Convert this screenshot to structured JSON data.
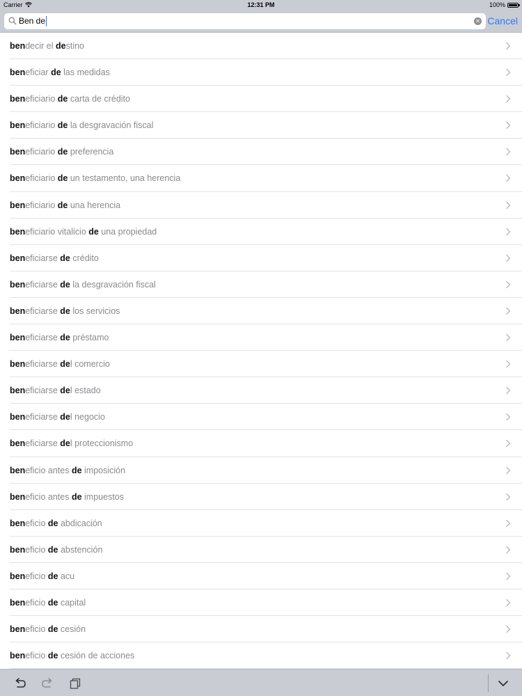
{
  "status_bar": {
    "carrier": "Carrier",
    "time": "12:31 PM",
    "battery": "100%"
  },
  "search": {
    "query": "Ben de",
    "cancel_label": "Cancel"
  },
  "results": [
    [
      {
        "t": "ben",
        "b": true
      },
      {
        "t": "decir el ",
        "b": false
      },
      {
        "t": "de",
        "b": true
      },
      {
        "t": "stino",
        "b": false
      }
    ],
    [
      {
        "t": "ben",
        "b": true
      },
      {
        "t": "eficiar ",
        "b": false
      },
      {
        "t": "de",
        "b": true
      },
      {
        "t": " las medidas",
        "b": false
      }
    ],
    [
      {
        "t": "ben",
        "b": true
      },
      {
        "t": "eficiario ",
        "b": false
      },
      {
        "t": "de",
        "b": true
      },
      {
        "t": " carta de crédito",
        "b": false
      }
    ],
    [
      {
        "t": "ben",
        "b": true
      },
      {
        "t": "eficiario ",
        "b": false
      },
      {
        "t": "de",
        "b": true
      },
      {
        "t": " la desgravación fiscal",
        "b": false
      }
    ],
    [
      {
        "t": "ben",
        "b": true
      },
      {
        "t": "eficiario ",
        "b": false
      },
      {
        "t": "de",
        "b": true
      },
      {
        "t": " preferencia",
        "b": false
      }
    ],
    [
      {
        "t": "ben",
        "b": true
      },
      {
        "t": "eficiario ",
        "b": false
      },
      {
        "t": "de",
        "b": true
      },
      {
        "t": " un testamento, una herencia",
        "b": false
      }
    ],
    [
      {
        "t": "ben",
        "b": true
      },
      {
        "t": "eficiario ",
        "b": false
      },
      {
        "t": "de",
        "b": true
      },
      {
        "t": " una herencia",
        "b": false
      }
    ],
    [
      {
        "t": "ben",
        "b": true
      },
      {
        "t": "eficiario vitalicio ",
        "b": false
      },
      {
        "t": "de",
        "b": true
      },
      {
        "t": " una propiedad",
        "b": false
      }
    ],
    [
      {
        "t": "ben",
        "b": true
      },
      {
        "t": "eficiarse ",
        "b": false
      },
      {
        "t": "de",
        "b": true
      },
      {
        "t": " crédito",
        "b": false
      }
    ],
    [
      {
        "t": "ben",
        "b": true
      },
      {
        "t": "eficiarse ",
        "b": false
      },
      {
        "t": "de",
        "b": true
      },
      {
        "t": " la desgravación fiscal",
        "b": false
      }
    ],
    [
      {
        "t": "ben",
        "b": true
      },
      {
        "t": "eficiarse ",
        "b": false
      },
      {
        "t": "de",
        "b": true
      },
      {
        "t": " los servicios",
        "b": false
      }
    ],
    [
      {
        "t": "ben",
        "b": true
      },
      {
        "t": "eficiarse ",
        "b": false
      },
      {
        "t": "de",
        "b": true
      },
      {
        "t": " prèstamo",
        "b": false
      }
    ],
    [
      {
        "t": "ben",
        "b": true
      },
      {
        "t": "eficiarse ",
        "b": false
      },
      {
        "t": "de",
        "b": true
      },
      {
        "t": "l comercio",
        "b": false
      }
    ],
    [
      {
        "t": "ben",
        "b": true
      },
      {
        "t": "eficiarse ",
        "b": false
      },
      {
        "t": "de",
        "b": true
      },
      {
        "t": "l estado",
        "b": false
      }
    ],
    [
      {
        "t": "ben",
        "b": true
      },
      {
        "t": "eficiarse ",
        "b": false
      },
      {
        "t": "de",
        "b": true
      },
      {
        "t": "l negocio",
        "b": false
      }
    ],
    [
      {
        "t": "ben",
        "b": true
      },
      {
        "t": "eficiarse ",
        "b": false
      },
      {
        "t": "de",
        "b": true
      },
      {
        "t": "l proteccionismo",
        "b": false
      }
    ],
    [
      {
        "t": "ben",
        "b": true
      },
      {
        "t": "eficio antes ",
        "b": false
      },
      {
        "t": "de",
        "b": true
      },
      {
        "t": " imposición",
        "b": false
      }
    ],
    [
      {
        "t": "ben",
        "b": true
      },
      {
        "t": "eficio antes ",
        "b": false
      },
      {
        "t": "de",
        "b": true
      },
      {
        "t": " impuestos",
        "b": false
      }
    ],
    [
      {
        "t": "ben",
        "b": true
      },
      {
        "t": "eficio ",
        "b": false
      },
      {
        "t": "de",
        "b": true
      },
      {
        "t": " abdicación",
        "b": false
      }
    ],
    [
      {
        "t": "ben",
        "b": true
      },
      {
        "t": "eficio ",
        "b": false
      },
      {
        "t": "de",
        "b": true
      },
      {
        "t": " abstención",
        "b": false
      }
    ],
    [
      {
        "t": "ben",
        "b": true
      },
      {
        "t": "eficio ",
        "b": false
      },
      {
        "t": "de",
        "b": true
      },
      {
        "t": " acu",
        "b": false
      }
    ],
    [
      {
        "t": "ben",
        "b": true
      },
      {
        "t": "eficio ",
        "b": false
      },
      {
        "t": "de",
        "b": true
      },
      {
        "t": " capital",
        "b": false
      }
    ],
    [
      {
        "t": "ben",
        "b": true
      },
      {
        "t": "eficio ",
        "b": false
      },
      {
        "t": "de",
        "b": true
      },
      {
        "t": " cesión",
        "b": false
      }
    ],
    [
      {
        "t": "ben",
        "b": true
      },
      {
        "t": "eficio ",
        "b": false
      },
      {
        "t": "de",
        "b": true
      },
      {
        "t": " cesión de acciones",
        "b": false
      }
    ]
  ],
  "icons": {
    "row_chevron": "chevron-right-icon",
    "toolbar": [
      "undo-icon",
      "redo-icon",
      "copy-icon",
      "chevron-down-icon"
    ]
  },
  "colors": {
    "accent": "#2f7cf6",
    "bar_background": "#c9ccd3",
    "match_text": "#111111",
    "rest_text": "#8a8a8f"
  }
}
